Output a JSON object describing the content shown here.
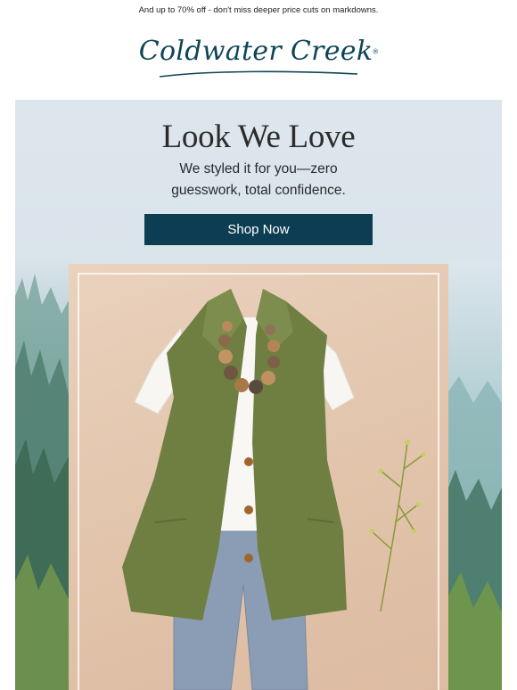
{
  "promo": {
    "text": "And up to 70% off - don't miss deeper price cuts on markdowns."
  },
  "brand": {
    "name": "Coldwater Creek",
    "trademark": "®",
    "color": "#0e4559"
  },
  "hero": {
    "title": "Look We Love",
    "subtitle": "We styled it for you—zero guesswork, total confidence.",
    "cta_label": "Shop Now",
    "cta_color": "#0d3d52"
  },
  "product_image": {
    "icons": [
      "vest-image",
      "necklace-image",
      "tee-image",
      "pants-image",
      "wildflower-sprig-image"
    ]
  }
}
